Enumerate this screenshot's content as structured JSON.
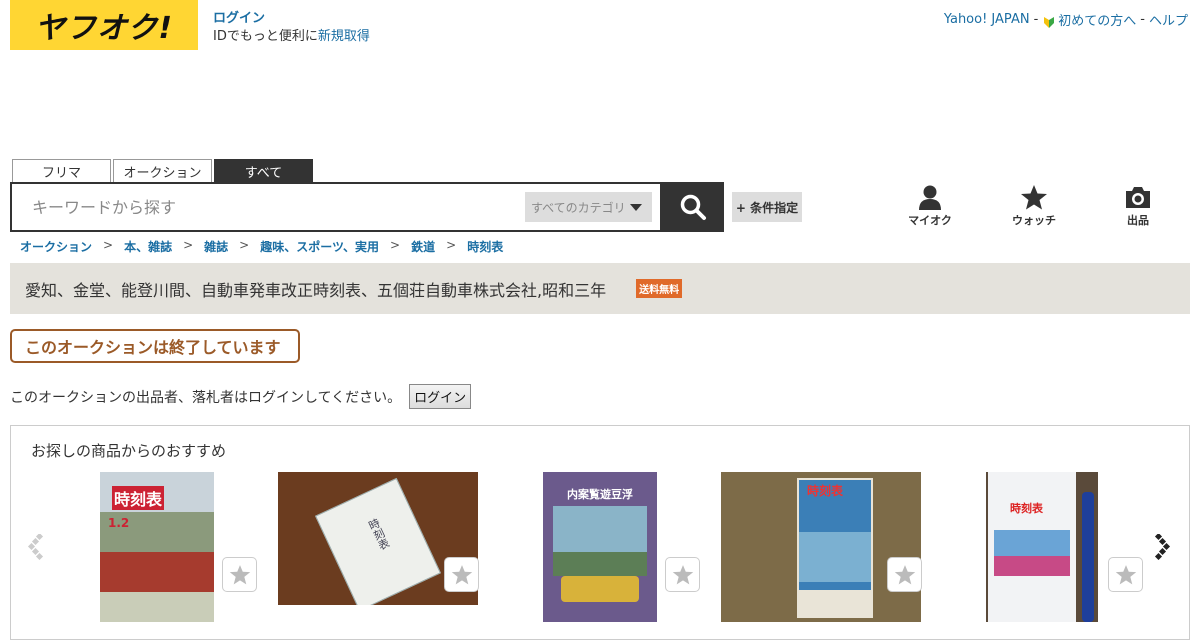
{
  "header": {
    "logo_text": "ヤフオク!",
    "login_label": "ログイン",
    "id_promo_text": "IDでもっと便利に",
    "signup_label": "新規取得",
    "yahoo_japan_label": "Yahoo! JAPAN",
    "separator": "-",
    "beginners_label": "初めての方へ",
    "help_label": "ヘルプ"
  },
  "search": {
    "tabs": [
      {
        "label": "フリマ",
        "active": false
      },
      {
        "label": "オークション",
        "active": false
      },
      {
        "label": "すべて",
        "active": true
      }
    ],
    "placeholder": "キーワードから探す",
    "category_label": "すべてのカテゴリ",
    "conditions_label": "+ 条件指定"
  },
  "utility": {
    "myauc_label": "マイオク",
    "watch_label": "ウォッチ",
    "sell_label": "出品"
  },
  "breadcrumb": [
    "オークション",
    "本、雑誌",
    "雑誌",
    "趣味、スポーツ、実用",
    "鉄道",
    "時刻表"
  ],
  "breadcrumb_sep": ">",
  "item": {
    "title": "愛知、金堂、能登川間、自動車発車改正時刻表、五個荘自動車株式会社,昭和三年",
    "free_shipping_badge": "送料無料"
  },
  "status": {
    "ended_message": "このオークションは終了しています",
    "login_note": "このオークションの出品者、落札者はログインしてください。",
    "login_button": "ログイン"
  },
  "recommend": {
    "title": "お探しの商品からのおすすめ",
    "items": [
      {
        "image_text": "時刻表",
        "image_sub": "1.2"
      },
      {
        "image_text": "時刻表"
      },
      {
        "image_text": "内案覧遊豆浮"
      },
      {
        "image_text": "時刻表"
      },
      {
        "image_text": "時刻表"
      }
    ]
  },
  "colors": {
    "brand_yellow": "#ffd633",
    "link_blue": "#1b6ea3",
    "dark": "#333333",
    "ended_brown": "#9b5a28",
    "badge_orange": "#e06a2a"
  }
}
